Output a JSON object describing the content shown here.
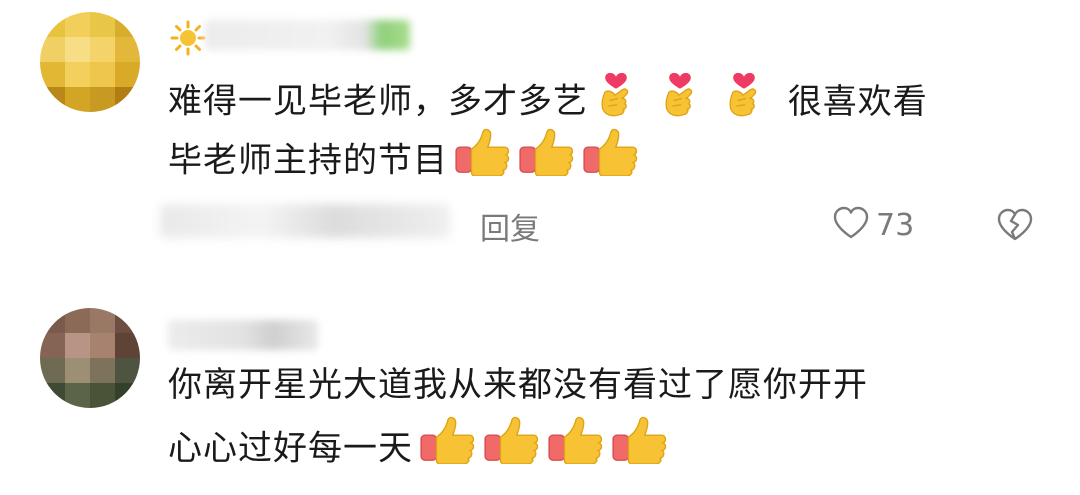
{
  "comments": [
    {
      "lines": [
        "难得一见毕老师，多才多艺",
        "很喜欢看",
        "毕老师主持的节目"
      ],
      "reply_label": "回复",
      "like_count": "73"
    },
    {
      "lines": [
        "你离开星光大道我从来都没有看过了愿你开开",
        "心心过好每一天"
      ]
    }
  ],
  "icons": {
    "heart_hands": "finger-heart-icon",
    "thumbs_up": "thumbs-up-icon",
    "like": "heart-outline-icon",
    "dislike": "broken-heart-icon",
    "sun_badge": "sun-icon"
  },
  "colors": {
    "text": "#1a1a1a",
    "muted": "#7a7a7a",
    "thumb_yellow": "#f7c335",
    "sleeve_red": "#f06a6a"
  }
}
